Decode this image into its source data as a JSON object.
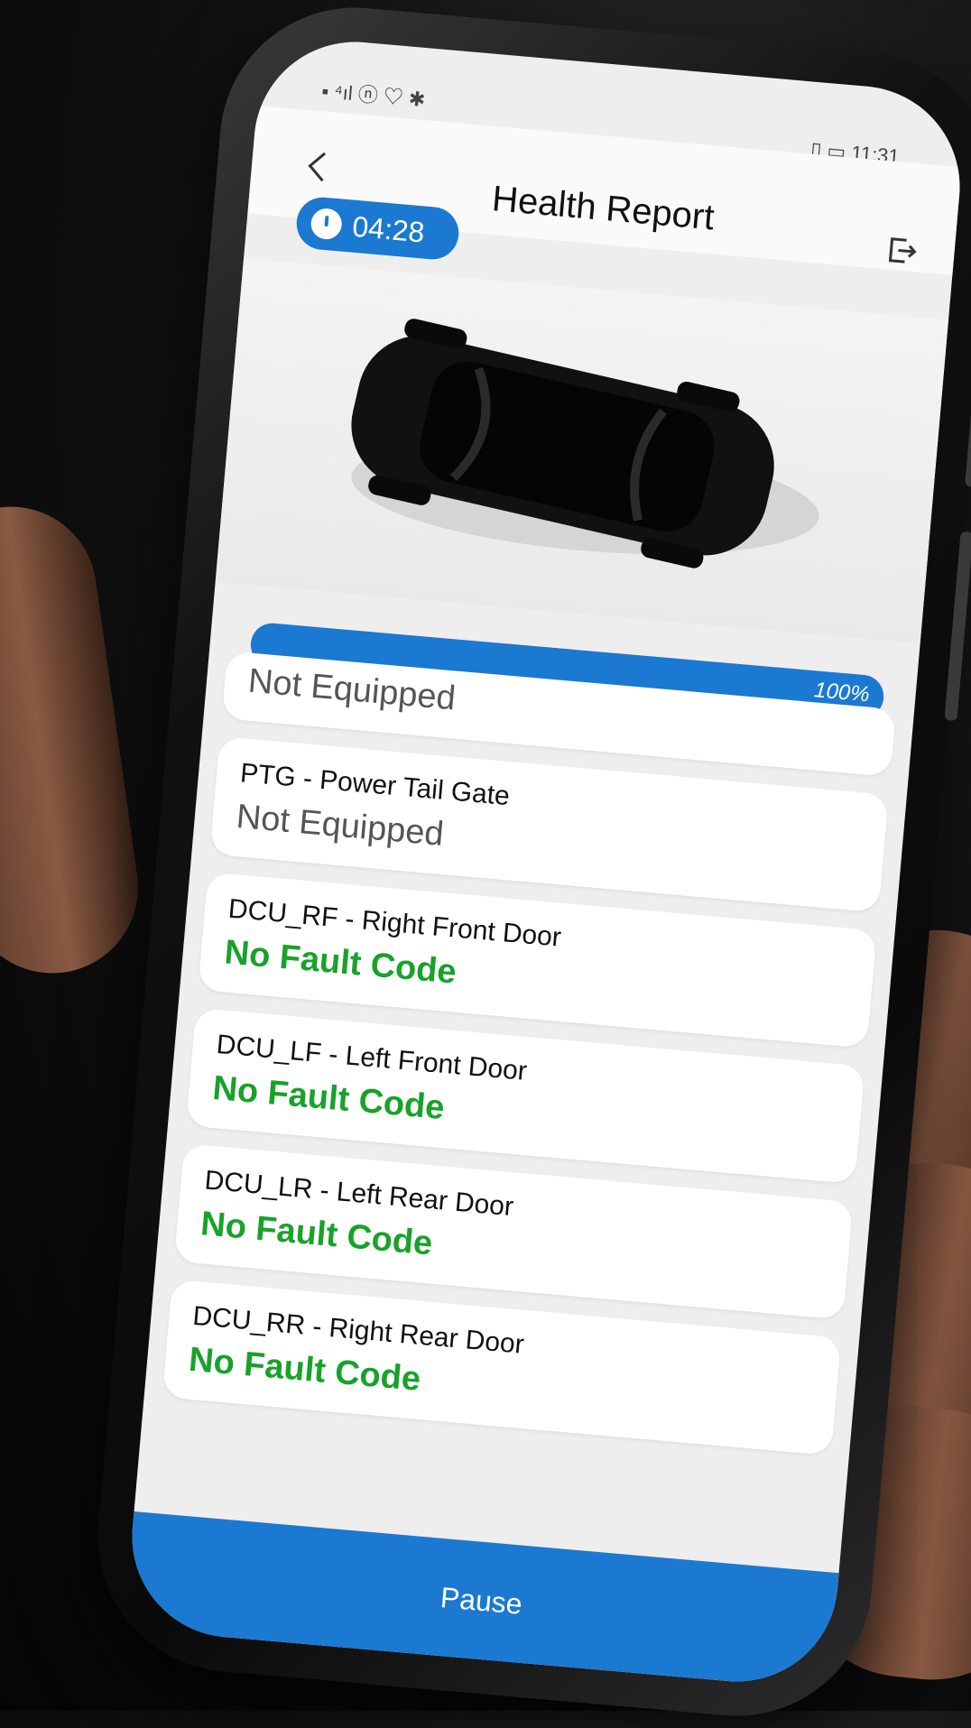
{
  "status_bar": {
    "left_icons": "▪ ⁴ıl ⓝ ♡ ✱",
    "time": "11:31",
    "battery_icon": "battery-icon"
  },
  "header": {
    "title": "Health Report"
  },
  "timer": {
    "value": "04:28"
  },
  "progress": {
    "label": "100%",
    "percent": 100
  },
  "modules": [
    {
      "name": "",
      "status": "Not Equipped",
      "state": "na"
    },
    {
      "name": "PTG - Power Tail Gate",
      "status": "Not Equipped",
      "state": "na"
    },
    {
      "name": "DCU_RF - Right Front Door",
      "status": "No Fault Code",
      "state": "ok"
    },
    {
      "name": "DCU_LF - Left Front Door",
      "status": "No Fault Code",
      "state": "ok"
    },
    {
      "name": "DCU_LR - Left Rear Door",
      "status": "No Fault Code",
      "state": "ok"
    },
    {
      "name": "DCU_RR - Right Rear Door",
      "status": "No Fault Code",
      "state": "ok"
    }
  ],
  "footer": {
    "pause_label": "Pause"
  },
  "colors": {
    "accent": "#1b79d1",
    "ok": "#18a22a",
    "na": "#555555"
  }
}
